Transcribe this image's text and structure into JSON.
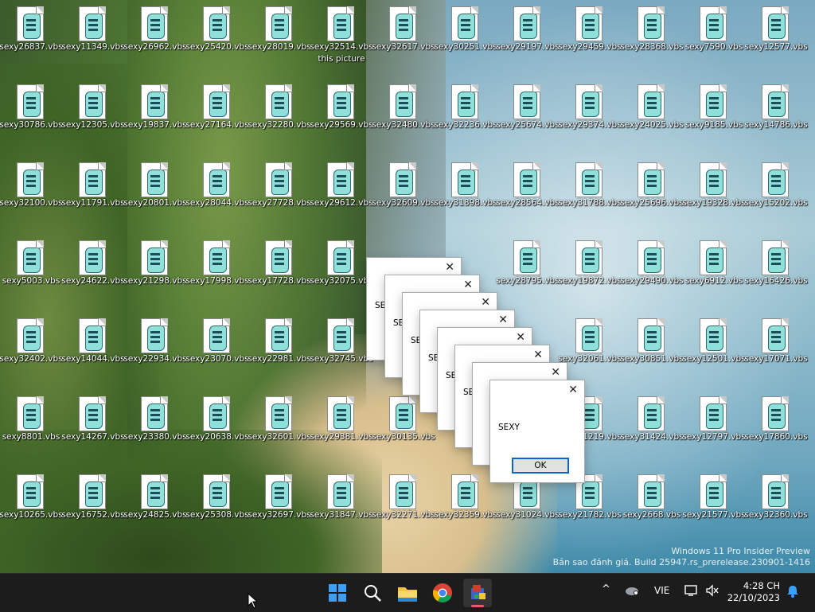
{
  "desktop": {
    "icons_row1": [
      "sexy26837.vbs",
      "sexy11349.vbs",
      "sexy26962.vbs",
      "sexy25420.vbs",
      "sexy28019.vbs",
      "sexy32514.vbs",
      "sexy32617.vbs",
      "sexy30251.vbs",
      "sexy29197.vbs",
      "sexy29459.vbs",
      "sexy28368.vbs",
      "sexy7590.vbs",
      "sexy12577.vbs"
    ],
    "icons_row2": [
      "sexy30786.vbs",
      "sexy12305.vbs",
      "sexy19837.vbs",
      "sexy27164.vbs",
      "sexy32280.vbs",
      "sexy29569.vbs",
      "sexy32480.vbs",
      "sexy32236.vbs",
      "sexy25674.vbs",
      "sexy29374.vbs",
      "sexy24025.vbs",
      "sexy9185.vbs",
      "sexy14786.vbs"
    ],
    "icons_row3": [
      "sexy32100.vbs",
      "sexy11791.vbs",
      "sexy20801.vbs",
      "sexy28044.vbs",
      "sexy27728.vbs",
      "sexy29612.vbs",
      "sexy32609.vbs",
      "sexy31898.vbs",
      "sexy28564.vbs",
      "sexy31788.vbs",
      "sexy25696.vbs",
      "sexy19328.vbs",
      "sexy15202.vbs"
    ],
    "icons_row4": [
      "sexy5003.vbs",
      "sexy24622.vbs",
      "sexy21298.vbs",
      "sexy17998.vbs",
      "sexy17728.vbs",
      "sexy32075.vbs",
      "",
      "",
      "sexy28795.vbs",
      "sexy19872.vbs",
      "sexy29490.vbs",
      "sexy6912.vbs",
      "sexy16426.vbs"
    ],
    "icons_row5": [
      "sexy32402.vbs",
      "sexy14044.vbs",
      "sexy22934.vbs",
      "sexy23070.vbs",
      "sexy22981.vbs",
      "sexy32745.vbs",
      "",
      "",
      "",
      "sexy32061.vbs",
      "sexy30851.vbs",
      "sexy12501.vbs",
      "sexy17071.vbs"
    ],
    "icons_row6": [
      "sexy8801.vbs",
      "sexy14267.vbs",
      "sexy23380.vbs",
      "sexy20638.vbs",
      "sexy32601.vbs",
      "sexy29381.vbs",
      "sexy30135.vbs",
      "",
      "",
      "sexy31219.vbs",
      "sexy31424.vbs",
      "sexy12797.vbs",
      "sexy17860.vbs"
    ],
    "icons_row7": [
      "sexy10265.vbs",
      "sexy16752.vbs",
      "sexy24825.vbs",
      "sexy25308.vbs",
      "sexy32697.vbs",
      "sexy31847.vbs",
      "sexy32271.vbs",
      "sexy32359.vbs",
      "sexy31024.vbs",
      "sexy21782.vbs",
      "sexy2668.vbs",
      "sexy21577.vbs",
      "sexy32360.vbs"
    ],
    "tooltip_under_icon": "this picture"
  },
  "dialogs": {
    "message": "SEXY",
    "ok_label": "OK",
    "close_glyph": "✕",
    "back_fragments": [
      "SE",
      "SE",
      "SE",
      "SE",
      "SE",
      "SEXY"
    ]
  },
  "watermark": {
    "line1": "Windows 11 Pro Insider Preview",
    "line2": "Bản sao đánh giá. Build 25947.rs_prerelease.230901-1416"
  },
  "taskbar": {
    "tray_lang": "VIE",
    "time": "4:28 CH",
    "date": "22/10/2023",
    "chevron": "^",
    "colors": {
      "bg": "#1c1c1c",
      "accent": "#0078d4"
    }
  }
}
